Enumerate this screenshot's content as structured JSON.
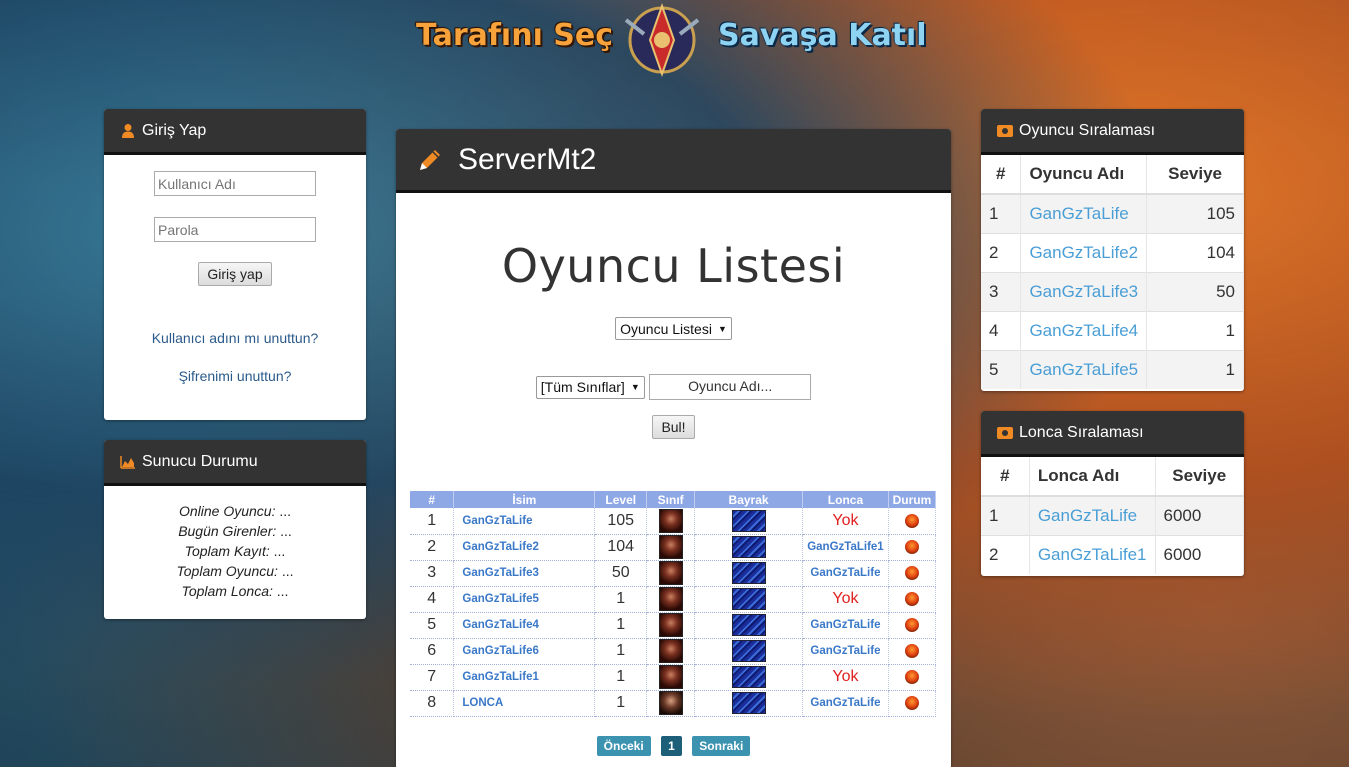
{
  "banner": {
    "left_text": "Tarafını Seç",
    "right_text": "Savaşa Katıl"
  },
  "login": {
    "title": "Giriş Yap",
    "username_placeholder": "Kullanıcı Adı",
    "password_placeholder": "Parola",
    "submit_label": "Giriş yap",
    "forgot_username": "Kullanıcı adını mı unuttun?",
    "forgot_password": "Şifrenimi unuttun?"
  },
  "status": {
    "title": "Sunucu Durumu",
    "rows": [
      {
        "label": "Online Oyuncu:",
        "value": "..."
      },
      {
        "label": "Bugün Girenler:",
        "value": "..."
      },
      {
        "label": "Toplam Kayıt:",
        "value": "..."
      },
      {
        "label": "Toplam Oyuncu:",
        "value": "..."
      },
      {
        "label": "Toplam Lonca:",
        "value": "..."
      }
    ]
  },
  "main": {
    "header_title": "ServerMt2",
    "page_title": "Oyuncu Listesi",
    "list_select": "Oyuncu Listesi",
    "class_select": "[Tüm Sınıflar]",
    "search_value": "Oyuncu Adı...",
    "search_button": "Bul!",
    "columns": [
      "#",
      "İsim",
      "Level",
      "Sınıf",
      "Bayrak",
      "Lonca",
      "Durum"
    ],
    "rows": [
      {
        "rank": "1",
        "name": "GanGzTaLife",
        "level": "105",
        "guild": "Yok"
      },
      {
        "rank": "2",
        "name": "GanGzTaLife2",
        "level": "104",
        "guild": "GanGzTaLife1"
      },
      {
        "rank": "3",
        "name": "GanGzTaLife3",
        "level": "50",
        "guild": "GanGzTaLife"
      },
      {
        "rank": "4",
        "name": "GanGzTaLife5",
        "level": "1",
        "guild": "Yok"
      },
      {
        "rank": "5",
        "name": "GanGzTaLife4",
        "level": "1",
        "guild": "GanGzTaLife"
      },
      {
        "rank": "6",
        "name": "GanGzTaLife6",
        "level": "1",
        "guild": "GanGzTaLife"
      },
      {
        "rank": "7",
        "name": "GanGzTaLife1",
        "level": "1",
        "guild": "Yok"
      },
      {
        "rank": "8",
        "name": "LONCA",
        "level": "1",
        "guild": "GanGzTaLife"
      }
    ],
    "pager": {
      "prev": "Önceki",
      "current": "1",
      "next": "Sonraki"
    }
  },
  "player_ranking": {
    "title": "Oyuncu Sıralaması",
    "columns": [
      "#",
      "Oyuncu Adı",
      "Seviye"
    ],
    "rows": [
      {
        "rank": "1",
        "name": "GanGzTaLife",
        "level": "105"
      },
      {
        "rank": "2",
        "name": "GanGzTaLife2",
        "level": "104"
      },
      {
        "rank": "3",
        "name": "GanGzTaLife3",
        "level": "50"
      },
      {
        "rank": "4",
        "name": "GanGzTaLife4",
        "level": "1"
      },
      {
        "rank": "5",
        "name": "GanGzTaLife5",
        "level": "1"
      }
    ]
  },
  "guild_ranking": {
    "title": "Lonca Sıralaması",
    "columns": [
      "#",
      "Lonca Adı",
      "Seviye"
    ],
    "rows": [
      {
        "rank": "1",
        "name": "GanGzTaLife",
        "level": "6000"
      },
      {
        "rank": "2",
        "name": "GanGzTaLife1",
        "level": "6000"
      }
    ]
  },
  "colors": {
    "header_bg": "#333333",
    "accent_orange": "#f08a24",
    "link_blue": "#4a9ed6",
    "table_head": "#8ea8e6"
  }
}
